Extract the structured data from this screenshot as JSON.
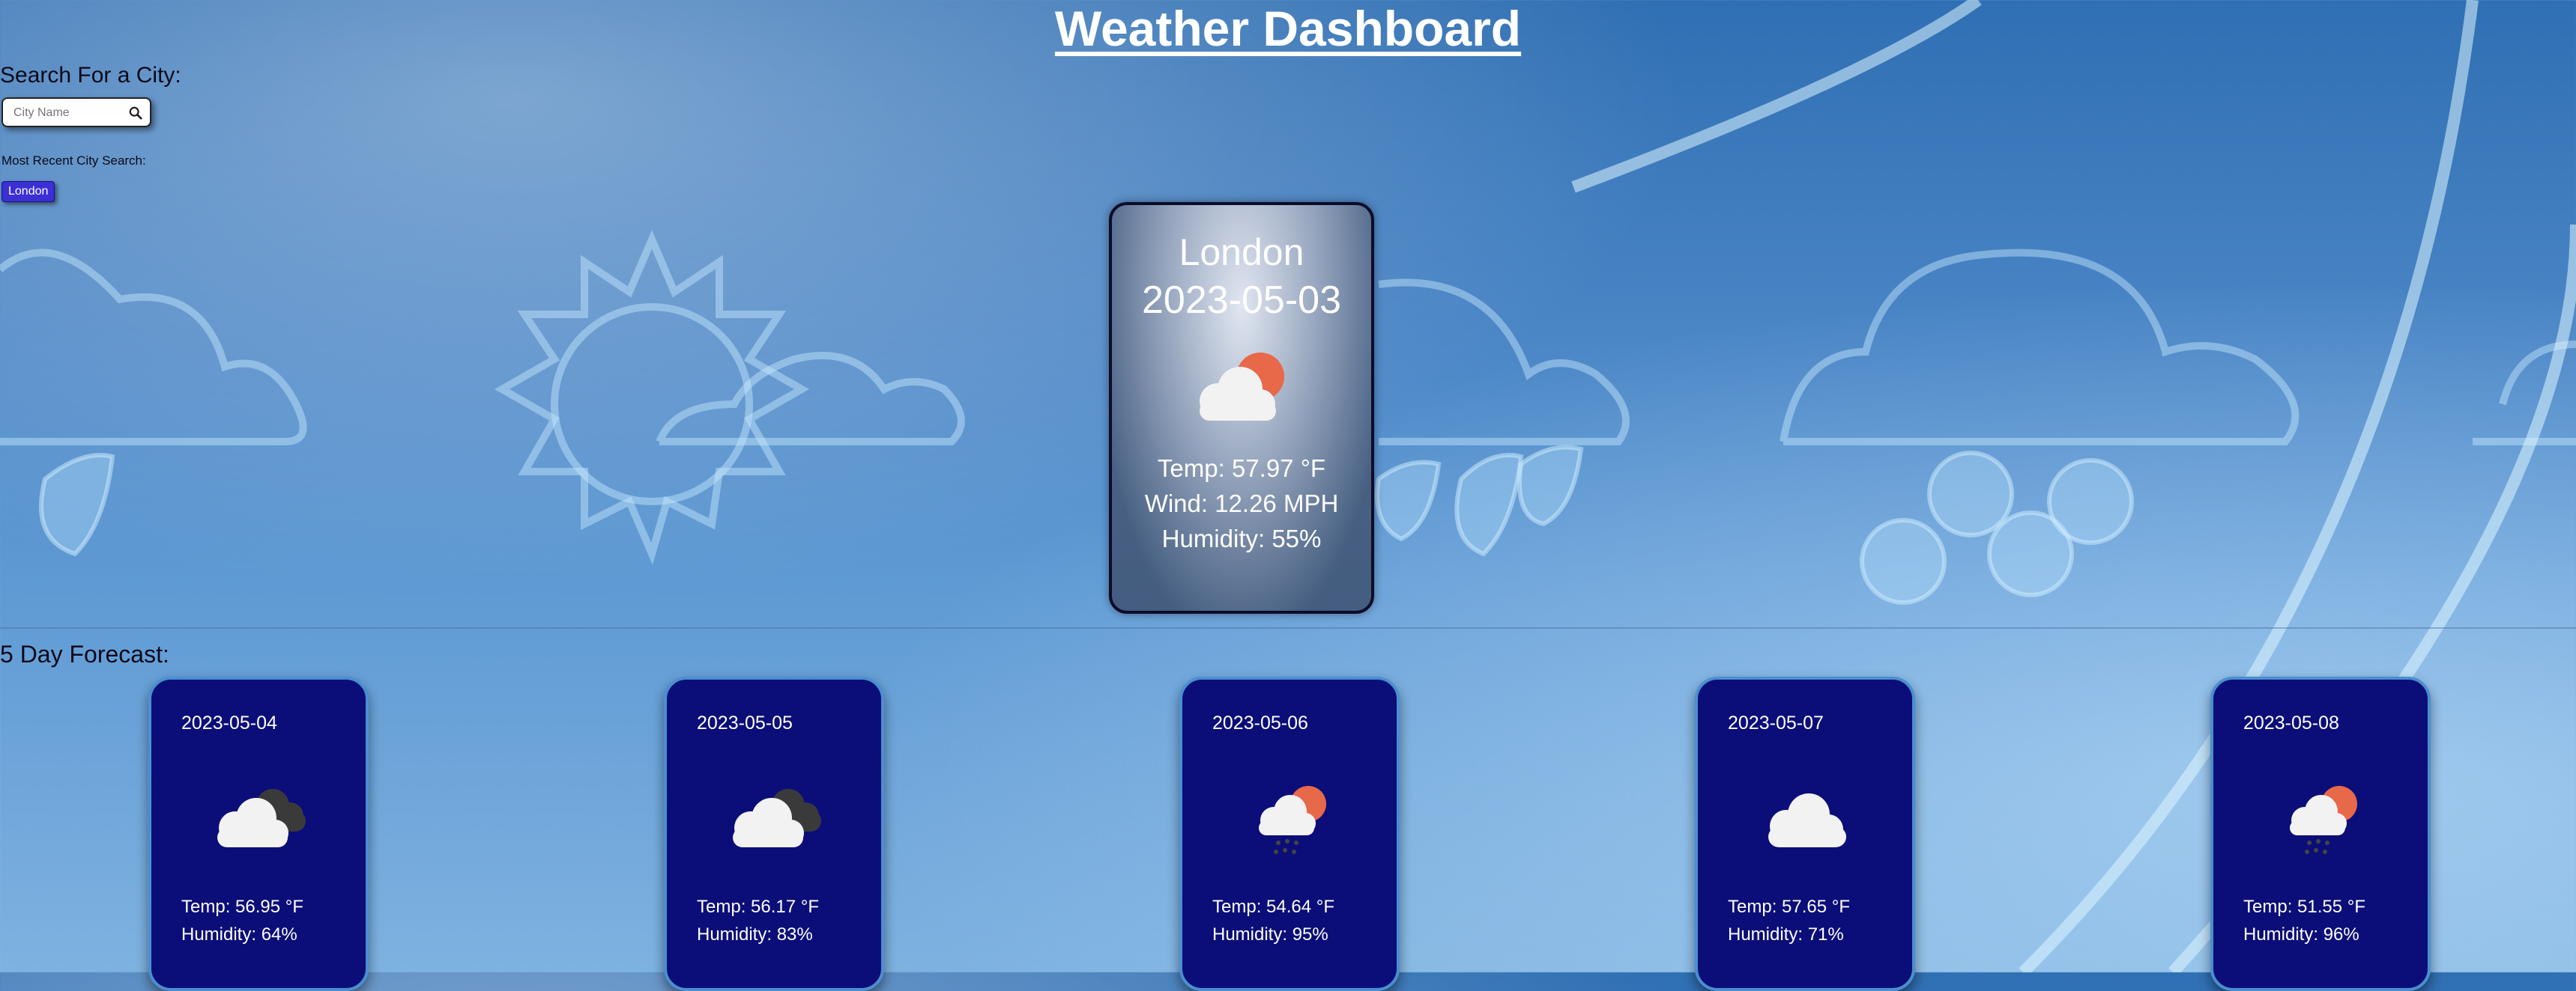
{
  "header": {
    "title": "Weather Dashboard"
  },
  "search": {
    "label": "Search For a City:",
    "placeholder": "City Name",
    "icon": "search-icon"
  },
  "recent": {
    "label": "Most Recent City Search:",
    "cities": [
      "London"
    ]
  },
  "current": {
    "city": "London",
    "date": "2023-05-03",
    "icon": "sun-behind-cloud-icon",
    "temp": "Temp: 57.97 °F",
    "wind": "Wind: 12.26 MPH",
    "humidity": "Humidity: 55%"
  },
  "forecast": {
    "label": "5 Day Forecast:",
    "days": [
      {
        "date": "2023-05-04",
        "icon": "broken-clouds-icon",
        "temp": "Temp: 56.95 °F",
        "humidity": "Humidity: 64%"
      },
      {
        "date": "2023-05-05",
        "icon": "broken-clouds-icon",
        "temp": "Temp: 56.17 °F",
        "humidity": "Humidity: 83%"
      },
      {
        "date": "2023-05-06",
        "icon": "sun-cloud-rain-icon",
        "temp": "Temp: 54.64 °F",
        "humidity": "Humidity: 95%"
      },
      {
        "date": "2023-05-07",
        "icon": "cloud-icon",
        "temp": "Temp: 57.65 °F",
        "humidity": "Humidity: 71%"
      },
      {
        "date": "2023-05-08",
        "icon": "sun-cloud-rain-icon",
        "temp": "Temp: 51.55 °F",
        "humidity": "Humidity: 96%"
      }
    ]
  },
  "colors": {
    "card_bg": "#0b0e78",
    "card_border": "#4a8fd0",
    "recent_button": "#3b2fd6",
    "sun": "#e8684a"
  }
}
